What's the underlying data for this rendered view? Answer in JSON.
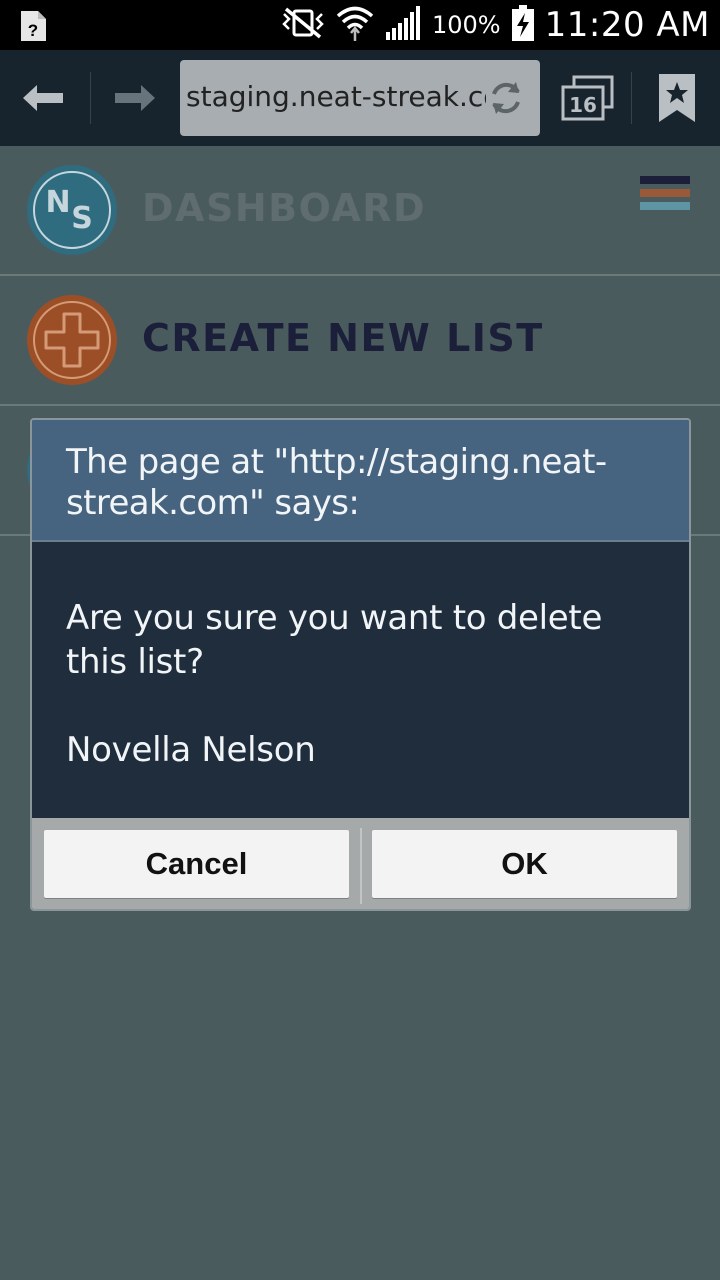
{
  "status_bar": {
    "battery_percent": "100%",
    "time": "11:20 AM",
    "icons": [
      "notification-unknown-icon",
      "vibrate-mute-icon",
      "wifi-icon",
      "cell-signal-icon",
      "battery-charging-icon"
    ]
  },
  "browser": {
    "url": "staging.neat-streak.com",
    "tab_count": "16",
    "icons": [
      "back-arrow-icon",
      "forward-arrow-icon",
      "reload-icon",
      "tabs-icon",
      "bookmark-icon"
    ]
  },
  "page": {
    "nav": [
      {
        "label": "DASHBOARD",
        "icon": "ns-logo-icon",
        "color": "#2f6c80"
      },
      {
        "label": "CREATE NEW LIST",
        "icon": "plus-circle-icon",
        "color": "#1b1f3a"
      }
    ],
    "menu_icon": "hamburger-menu-icon",
    "hamburger_colors": [
      "#1b1f3a",
      "#9a5a3a",
      "#5f95a3"
    ]
  },
  "dialog": {
    "title": "The page at \"http://staging.neat-streak.com\" says:",
    "message": "Are you sure you want to delete this list?",
    "item_name": "Novella Nelson",
    "cancel_label": "Cancel",
    "ok_label": "OK"
  },
  "colors": {
    "overlay_bg": "#4a5b5e",
    "toolbar_bg": "#17242e",
    "dialog_title_bg": "#46637f",
    "dialog_body_bg": "#1f2d3c",
    "accent_orange": "#b35a2a",
    "accent_blue": "#2f7fa3"
  }
}
